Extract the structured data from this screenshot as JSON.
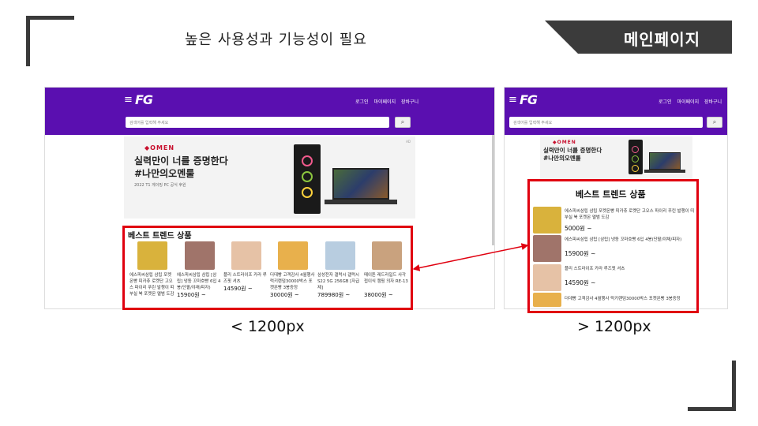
{
  "slide": {
    "subtitle": "높은 사용성과 기능성이 필요",
    "title_tag": "메인페이지",
    "caption_left": "< 1200px",
    "caption_right": "> 1200px"
  },
  "site": {
    "logo": "FG",
    "menu_icon": "≡",
    "links": [
      "로그인",
      "마이페이지",
      "장바구니"
    ],
    "search_placeholder": "검색어를 입력해 주세요",
    "search_icon": "magnifier-icon"
  },
  "banner": {
    "brand": "◆OMEN",
    "line1": "실력만이 너를 증명한다",
    "line2": "#나만의오멘룰",
    "note": "2022 T1 게이밍 PC 공식 후원",
    "ad": "AD"
  },
  "best": {
    "title": "베스트 트렌드 상품",
    "products_left": [
      {
        "name": "에스피씨삼립 삼립 포켓몬빵 피카츄 로켓단 고오스 파이리 푸린 발챙이 띠부실 북 포켓몬 앨범 도감",
        "price": "",
        "color": "#d9b23c"
      },
      {
        "name": "에스피씨삼립 삼립 [삼립] 냉동 꼬마호빵 6입 4봉(단팥/야채/피자)",
        "price": "15900원 ~",
        "color": "#a0746a"
      },
      {
        "name": "플리 스트라이프 카라 루즈핏 셔츠",
        "price": "14590원 ~",
        "color": "#e6c2a6"
      },
      {
        "name": "더데빵 고객감사 4월행사 럭키랜덤30000박스 포켓몬빵 3봉증정",
        "price": "30000원 ~",
        "color": "#e8b04c"
      },
      {
        "name": "삼성전자 갤럭시 갤럭시S22 5G 256GB [자급제]",
        "price": "789980원 ~",
        "color": "#b8cde0"
      },
      {
        "name": "메이튼 레드라일드 사각 접이식 캠핑 의자 RE-13",
        "price": "38000원 ~",
        "color": "#c9a27e"
      }
    ],
    "products_right": [
      {
        "name": "에스피씨삼립 삼립 포켓몬빵 피카츄 로켓단 고오스 파이리 푸린 발챙이 띠부실 북 포켓몬 앨범 도감",
        "price": "5000원 ~",
        "color": "#d9b23c"
      },
      {
        "name": "에스피씨삼립 삼립 [삼립] 냉동 꼬마호빵 6입 4봉(단팥/야채/피자)",
        "price": "15900원 ~",
        "color": "#a0746a"
      },
      {
        "name": "플리 스트라이프 카라 루즈핏 셔츠",
        "price": "14590원 ~",
        "color": "#e6c2a6"
      },
      {
        "name": "더데빵 고객감사 4월행사 럭키랜덤30000박스 포켓몬빵 3봉증정",
        "price": "",
        "color": "#e8b04c"
      }
    ]
  },
  "colors": {
    "header": "#5a0fb0",
    "highlight": "#e0000f",
    "tag": "#3b3b3b"
  }
}
